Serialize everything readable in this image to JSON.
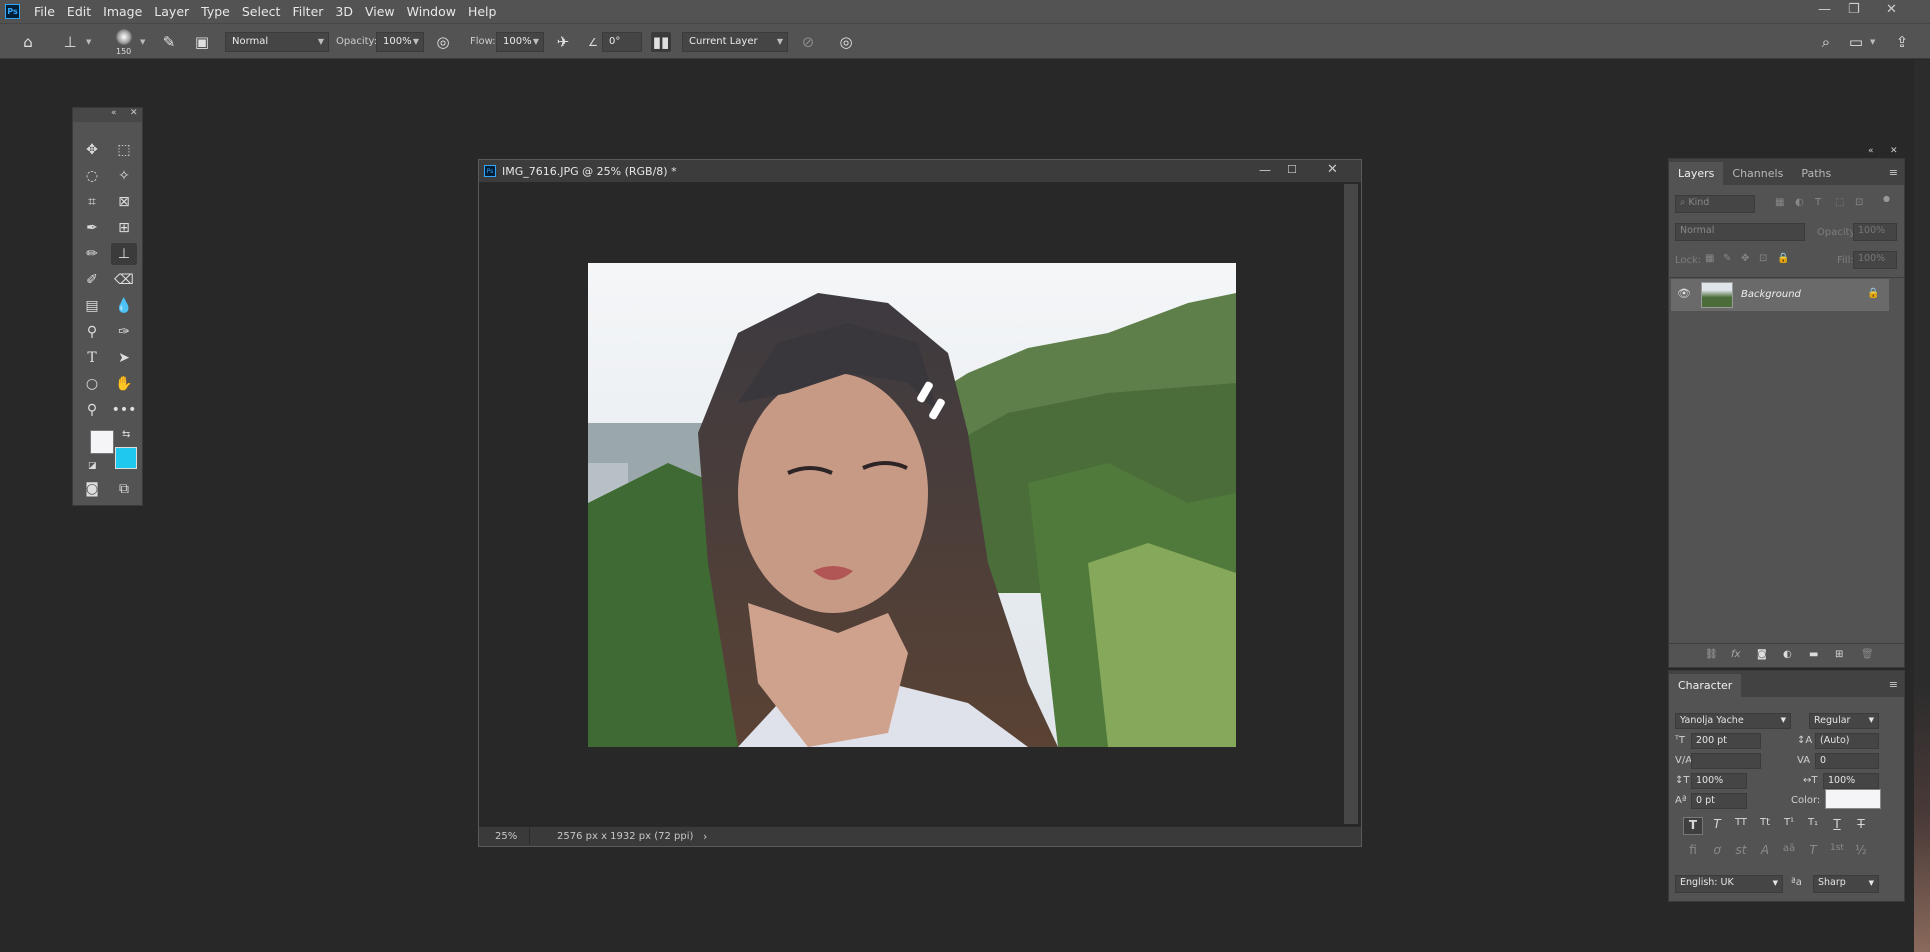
{
  "app": {
    "logo": "Ps"
  },
  "menu": [
    "File",
    "Edit",
    "Image",
    "Layer",
    "Type",
    "Select",
    "Filter",
    "3D",
    "View",
    "Window",
    "Help"
  ],
  "options": {
    "brush_size": "150",
    "mode": "Normal",
    "opacity_label": "Opacity:",
    "opacity": "100%",
    "flow_label": "Flow:",
    "flow": "100%",
    "angle": "0°",
    "sample": "Current Layer"
  },
  "document": {
    "title": "IMG_7616.JPG @ 25% (RGB/8) *",
    "zoom": "25%",
    "info": "2576 px x 1932 px (72 ppi)"
  },
  "layers_panel": {
    "tabs": [
      "Layers",
      "Channels",
      "Paths"
    ],
    "kind_placeholder": "Kind",
    "blend": "Normal",
    "opacity_label": "Opacity:",
    "opacity": "100%",
    "lock_label": "Lock:",
    "fill_label": "Fill:",
    "fill": "100%",
    "layer_name": "Background"
  },
  "character_panel": {
    "title": "Character",
    "font": "Yanolja Yache",
    "style": "Regular",
    "size": "200 pt",
    "leading": "(Auto)",
    "kerning": "",
    "tracking": "0",
    "vscale": "100%",
    "hscale": "100%",
    "baseline": "0 pt",
    "color_label": "Color:",
    "language": "English: UK",
    "antialias": "Sharp",
    "type_buttons": [
      "T",
      "T",
      "TT",
      "Tt",
      "T¹",
      "T₁",
      "T",
      "T"
    ],
    "opentype_buttons": [
      "ﬁ",
      "ơ",
      "st",
      "A",
      "aā",
      "T",
      "1st",
      "½"
    ]
  },
  "colors": {
    "foreground": "#f5f5f7",
    "background": "#1ec8ef",
    "ui_bar": "#535353",
    "workspace": "#282828"
  }
}
